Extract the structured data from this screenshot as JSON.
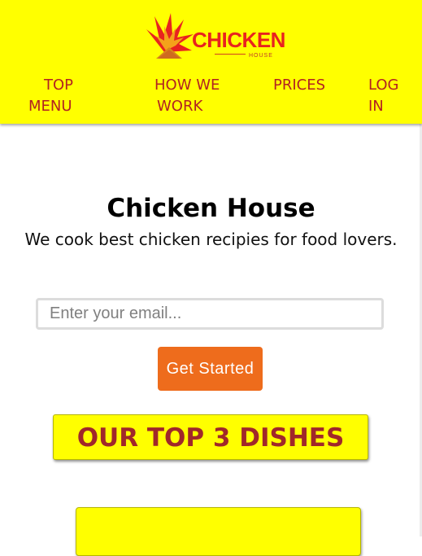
{
  "brand": {
    "logo_word": "CHICKEN",
    "logo_sub": "HOUSE",
    "colors": {
      "header_bg": "#ffff00",
      "nav_text": "#b22222",
      "logo_red": "#e8231f",
      "cta_bg": "#ee6c1c",
      "banner_text": "#a0282a"
    }
  },
  "nav": {
    "items": [
      {
        "line1": "TOP",
        "line2": "MENU"
      },
      {
        "line1": "HOW WE",
        "line2": "WORK"
      },
      {
        "line1": "PRICES",
        "line2": ""
      },
      {
        "line1": "LOG",
        "line2": "IN"
      }
    ]
  },
  "hero": {
    "title": "Chicken House",
    "subtitle": "We cook best chicken recipies for food lovers."
  },
  "signup": {
    "email_placeholder": "Enter your email...",
    "email_value": "",
    "cta_label": "Get Started"
  },
  "dishes": {
    "banner": "OUR TOP 3 DISHES"
  },
  "icons": {
    "logo": "chicken-flame-logo-icon"
  }
}
